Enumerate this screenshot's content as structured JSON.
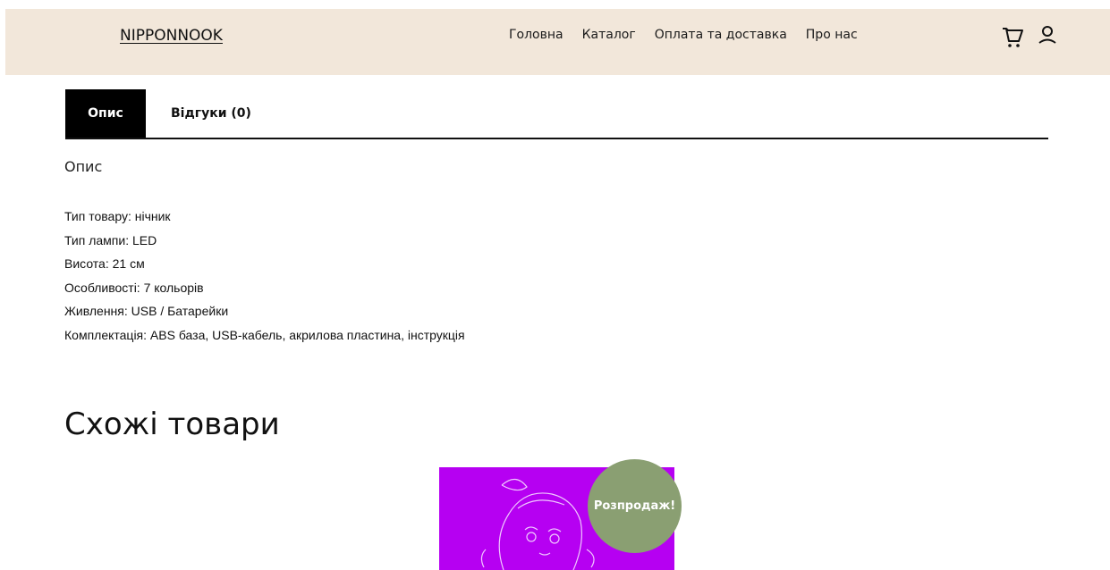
{
  "header": {
    "logo": "NIPPONNOOK",
    "nav": [
      "Головна",
      "Каталог",
      "Оплата та доставка",
      "Про нас"
    ],
    "icons": [
      "cart-icon",
      "user-icon"
    ]
  },
  "tabs": {
    "description": "Опис",
    "reviews": "Відгуки (0)"
  },
  "description": {
    "heading": "Опис",
    "lines": [
      "Тип товару: нічник",
      "Тип лампи: LED",
      "Висота: 21 см",
      "Особливості: 7 кольорів",
      "Живлення: USB / Батарейки",
      "Комплектація: ABS база, USB-кабель, акрилова пластина, інструкція"
    ]
  },
  "similar": {
    "title": "Схожі товари",
    "badge": "Розпродаж!"
  },
  "colors": {
    "header_bg": "#f2e7da",
    "product_bg": "#b600f2",
    "sale_badge": "#8a9f72"
  }
}
